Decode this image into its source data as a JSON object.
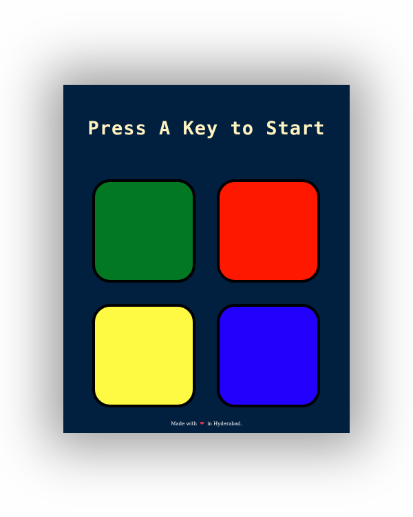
{
  "game": {
    "title": "Press A Key to Start",
    "buttons": [
      {
        "id": "green",
        "color": "#037822"
      },
      {
        "id": "red",
        "color": "#fe1800"
      },
      {
        "id": "yellow",
        "color": "#fefa43"
      },
      {
        "id": "blue",
        "color": "#2300fb"
      }
    ]
  },
  "footer": {
    "prefix": "Made with",
    "heart_icon": "heart-icon",
    "suffix": "in Hyderabad."
  },
  "colors": {
    "background": "#011f3f",
    "title_text": "#fef2bf",
    "button_border": "#000000",
    "heart": "#e0334f"
  }
}
